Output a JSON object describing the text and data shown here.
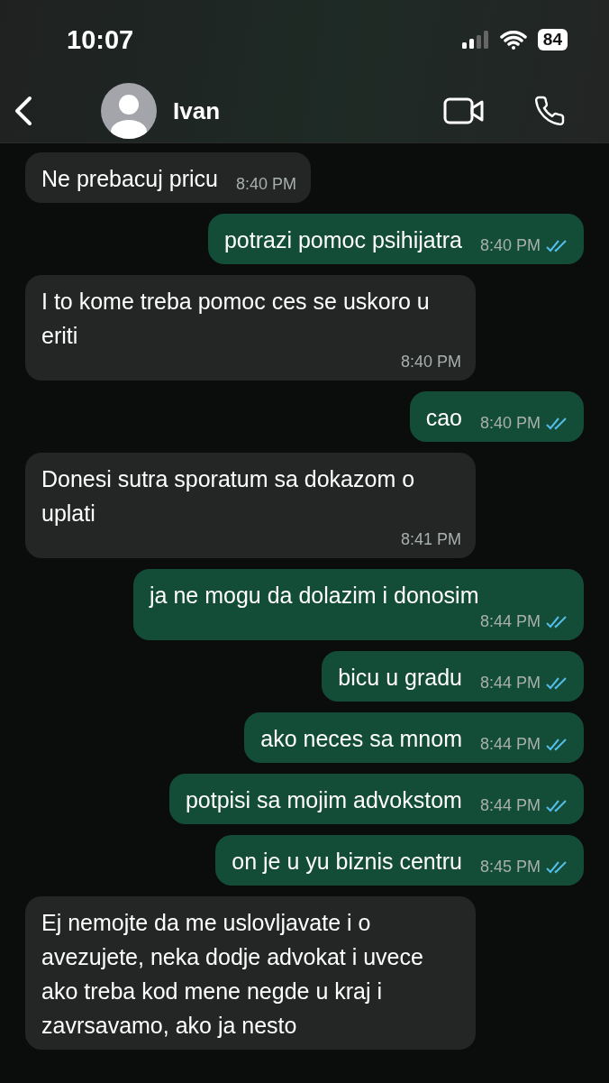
{
  "status_bar": {
    "time": "10:07",
    "battery": "84"
  },
  "header": {
    "contact": "Ivan"
  },
  "messages": [
    {
      "kind": "in",
      "text": "Ne prebacuj pricu",
      "time": "8:40 PM"
    },
    {
      "kind": "out",
      "text": "potrazi pomoc psihijatra",
      "time": "8:40 PM",
      "read": true
    },
    {
      "kind": "in",
      "text": "I to kome treba pomoc ces se uskoro u eriti",
      "time": "8:40 PM"
    },
    {
      "kind": "out",
      "text": "cao",
      "time": "8:40 PM",
      "read": true
    },
    {
      "kind": "in",
      "text": "Donesi sutra sporatum sa dokazom o uplati",
      "time": "8:41 PM"
    },
    {
      "kind": "out",
      "text": "ja ne mogu da dolazim i donosim",
      "time": "8:44 PM",
      "read": true
    },
    {
      "kind": "out",
      "text": "bicu u gradu",
      "time": "8:44 PM",
      "read": true
    },
    {
      "kind": "out",
      "text": "ako neces sa mnom",
      "time": "8:44 PM",
      "read": true
    },
    {
      "kind": "out",
      "text": "potpisi sa mojim advokstom",
      "time": "8:44 PM",
      "read": true
    },
    {
      "kind": "out",
      "text": "on je u yu biznis centru",
      "time": "8:45 PM",
      "read": true
    },
    {
      "kind": "in",
      "text": "Ej nemojte da me uslovljavate i o avezujete, neka dodje advokat i uvece ako treba kod mene negde u kraj i zavrsavamo, ako ja nesto"
    }
  ]
}
